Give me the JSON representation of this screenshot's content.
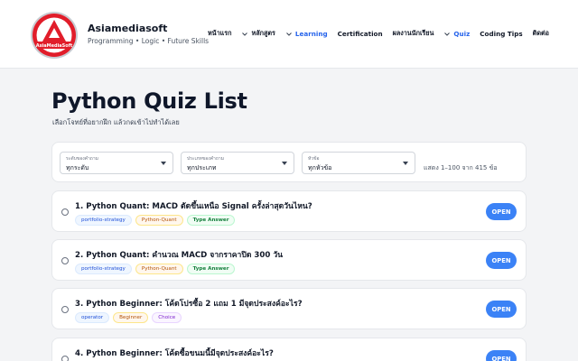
{
  "brand": {
    "logo_text": "AsiaMediaSoft",
    "name": "Asiamediasoft",
    "tagline": "Programming • Logic • Future Skills"
  },
  "nav": {
    "home": "หน้าแรก",
    "courses": "หลักสูตร",
    "learning": "Learning",
    "certification": "Certification",
    "student_work": "ผลงานนักเรียน",
    "quiz": "Quiz",
    "coding_tips": "Coding Tips",
    "contact": "ติดต่อ"
  },
  "page": {
    "title": "Python Quiz List",
    "subtitle": "เลือกโจทย์ที่อยากฝึก แล้วกดเข้าไปทำได้เลย"
  },
  "filters": {
    "level": {
      "label": "ระดับของคำถาม",
      "value": "ทุกระดับ"
    },
    "type": {
      "label": "ประเภทของคำถาม",
      "value": "ทุกประเภท"
    },
    "topic": {
      "label": "หัวข้อ",
      "value": "ทุกหัวข้อ"
    },
    "count_text": "แสดง 1–100 จาก 415 ข้อ"
  },
  "quizzes": [
    {
      "title": "1. Python Quant: MACD ตัดขึ้นเหนือ Signal ครั้งล่าสุดวันไหน?",
      "tags": [
        "portfolio-strategy",
        "Python-Quant",
        "Type Answer"
      ],
      "action": "OPEN"
    },
    {
      "title": "2. Python Quant: คำนวณ MACD จากราคาปิด 300 วัน",
      "tags": [
        "portfolio-strategy",
        "Python-Quant",
        "Type Answer"
      ],
      "action": "OPEN"
    },
    {
      "title": "3. Python Beginner: โค้ดโปรซื้อ 2 แถม 1 มีจุดประสงค์อะไร?",
      "tags": [
        "operator",
        "Beginner",
        "Choice"
      ],
      "action": "OPEN"
    },
    {
      "title": "4. Python Beginner: โค้ดซื้อขนมนี้มีจุดประสงค์อะไร?",
      "tags": [],
      "action": "OPEN"
    }
  ],
  "colors": {
    "accent": "#3b82f6",
    "nav_active": "#2563eb",
    "logo_red": "#e11d2a",
    "background": "#f3f4f6"
  }
}
